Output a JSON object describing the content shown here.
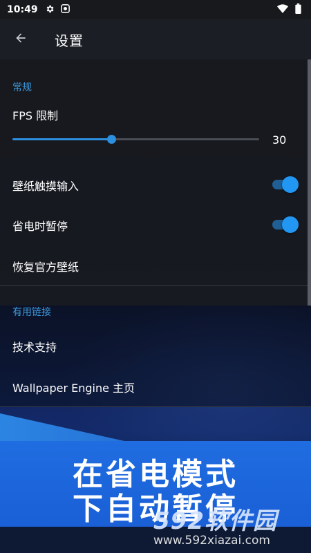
{
  "status_bar": {
    "time": "10:49"
  },
  "app_bar": {
    "title": "设置"
  },
  "general": {
    "header": "常规",
    "fps": {
      "label": "FPS 限制",
      "value": "30",
      "fraction": 0.4
    },
    "touch_input": {
      "label": "壁纸触摸输入",
      "enabled": true
    },
    "pause_battery": {
      "label": "省电时暂停",
      "enabled": true
    },
    "restore": {
      "label": "恢复官方壁纸"
    }
  },
  "links": {
    "header": "有用链接",
    "support": "技术支持",
    "home": "Wallpaper Engine 主页"
  },
  "banner": {
    "line1": "在省电模式",
    "line2": "下自动暂停"
  },
  "watermark": {
    "logo": "592软件园",
    "url": "www.592xiazai.com"
  },
  "colors": {
    "accent": "#2d8fe0",
    "banner": "#1f6de0"
  }
}
